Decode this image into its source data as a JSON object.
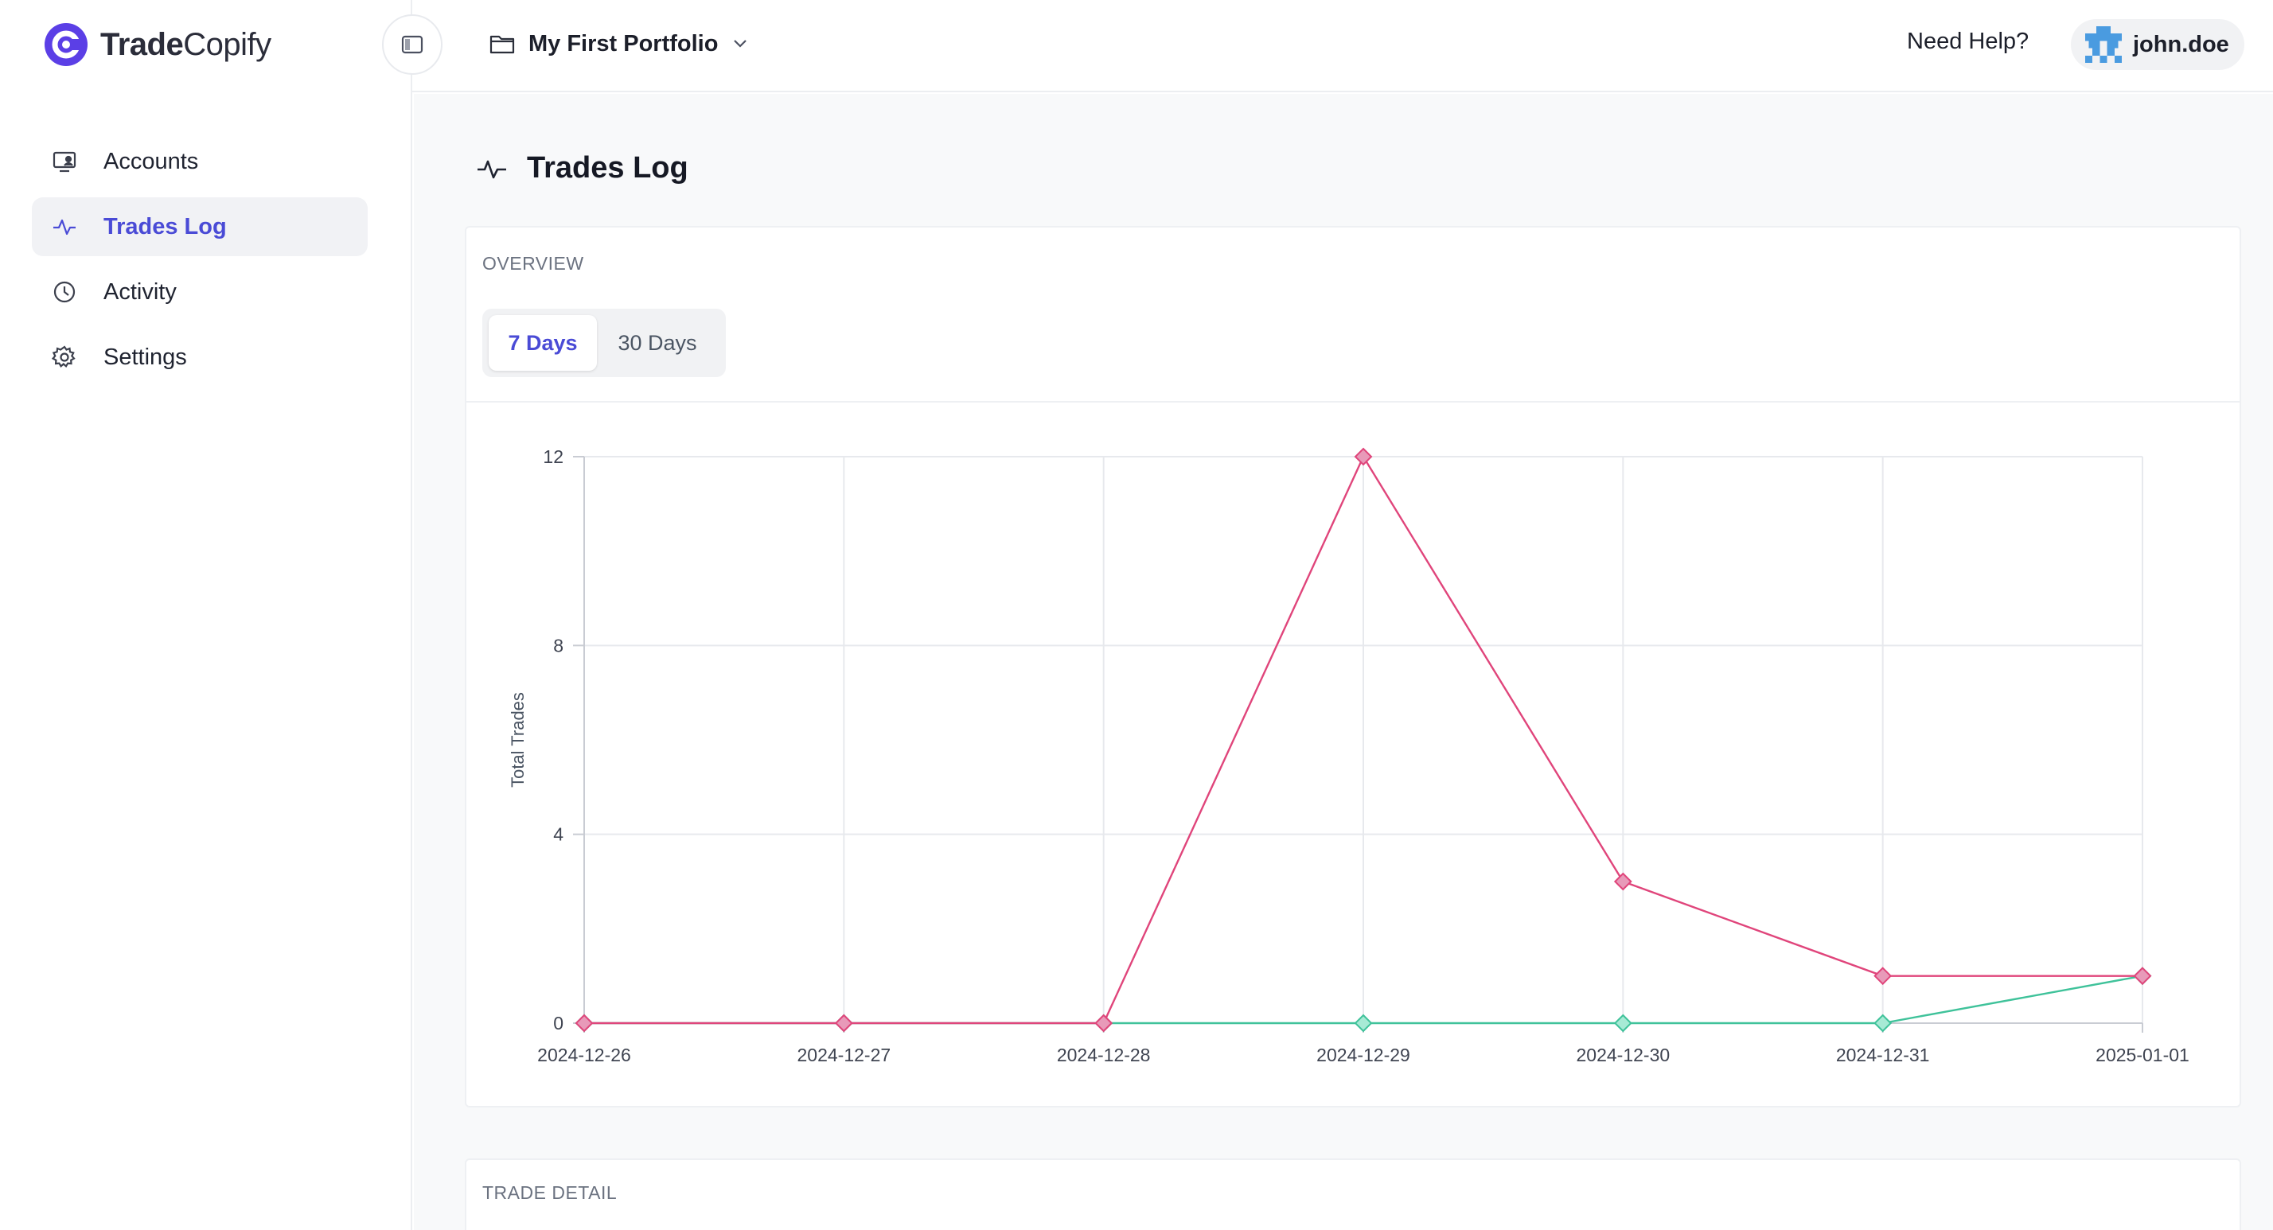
{
  "brand": {
    "name_bold": "Trade",
    "name_regular": "Copify",
    "logo_color": "#5b3fe6"
  },
  "sidebar": {
    "items": [
      {
        "label": "Accounts",
        "icon": "monitor-user-icon",
        "active": false
      },
      {
        "label": "Trades Log",
        "icon": "activity-icon",
        "active": true
      },
      {
        "label": "Activity",
        "icon": "clock-icon",
        "active": false
      },
      {
        "label": "Settings",
        "icon": "gear-icon",
        "active": false
      }
    ]
  },
  "topbar": {
    "portfolio_label": "My First Portfolio",
    "help_label": "Need Help?",
    "username": "john.doe"
  },
  "page": {
    "title": "Trades Log"
  },
  "overview": {
    "label": "OVERVIEW",
    "tabs": [
      {
        "label": "7 Days",
        "selected": true
      },
      {
        "label": "30 Days",
        "selected": false
      }
    ]
  },
  "trade_detail": {
    "label": "TRADE DETAIL"
  },
  "colors": {
    "accent": "#4a4bd6",
    "series_pink": "#e0457b",
    "series_green": "#3fc29a"
  },
  "chart_data": {
    "type": "line",
    "x": [
      "2024-12-26",
      "2024-12-27",
      "2024-12-28",
      "2024-12-29",
      "2024-12-30",
      "2024-12-31",
      "2025-01-01"
    ],
    "series": [
      {
        "values": [
          0,
          0,
          0,
          12,
          3,
          1,
          1
        ],
        "color": "#e0457b",
        "marker": "diamond"
      },
      {
        "values": [
          0,
          0,
          0,
          0,
          0,
          0,
          1
        ],
        "color": "#3fc29a",
        "marker": "diamond"
      }
    ],
    "ylabel": "Total Trades",
    "ylim": [
      0,
      12
    ],
    "yticks": [
      0,
      4,
      8,
      12
    ],
    "grid": true
  }
}
